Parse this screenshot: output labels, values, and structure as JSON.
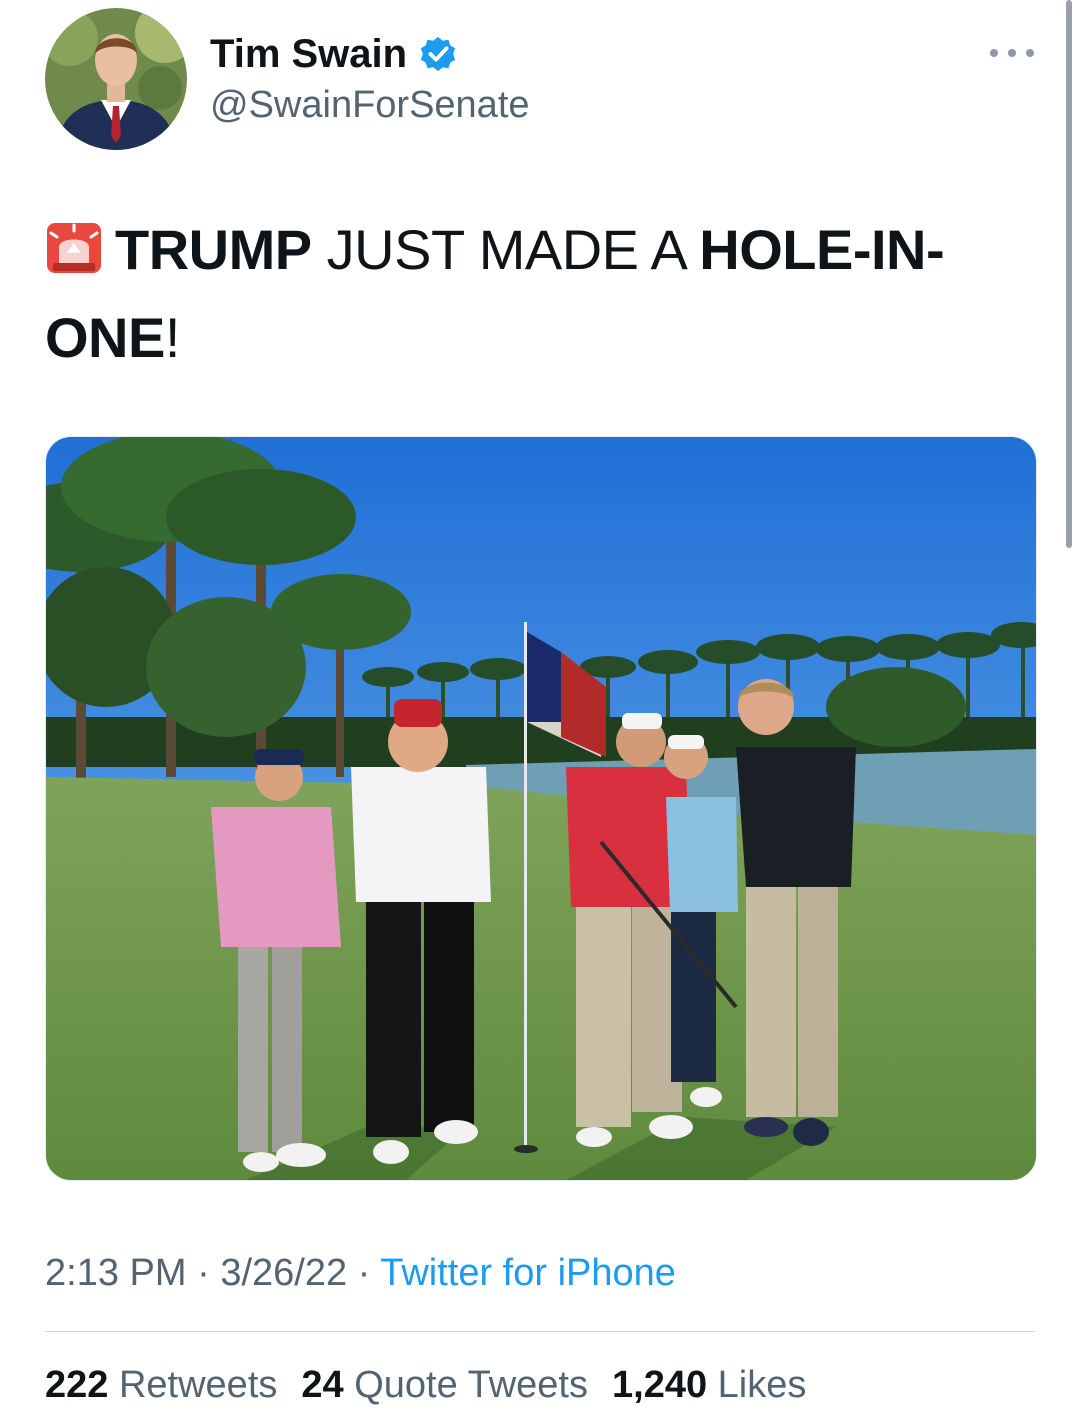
{
  "author": {
    "display_name": "Tim Swain",
    "handle": "@SwainForSenate",
    "verified": true
  },
  "tweet": {
    "emoji": "rotating-light-siren",
    "text_bold_1": "TRUMP",
    "text_regular_1": " JUST MADE A ",
    "text_bold_2": "HOLE-IN-ONE",
    "text_regular_2": "!"
  },
  "meta": {
    "time": "2:13 PM",
    "separator": " · ",
    "date": "3/26/22",
    "source": "Twitter for iPhone"
  },
  "stats": {
    "retweets_count": "222",
    "retweets_label": "Retweets",
    "quotes_count": "24",
    "quotes_label": "Quote Tweets",
    "likes_count": "1,240",
    "likes_label": "Likes"
  },
  "colors": {
    "link": "#1d9bf0",
    "muted": "#536471",
    "text": "#0f1419",
    "verified": "#1d9bf0"
  }
}
